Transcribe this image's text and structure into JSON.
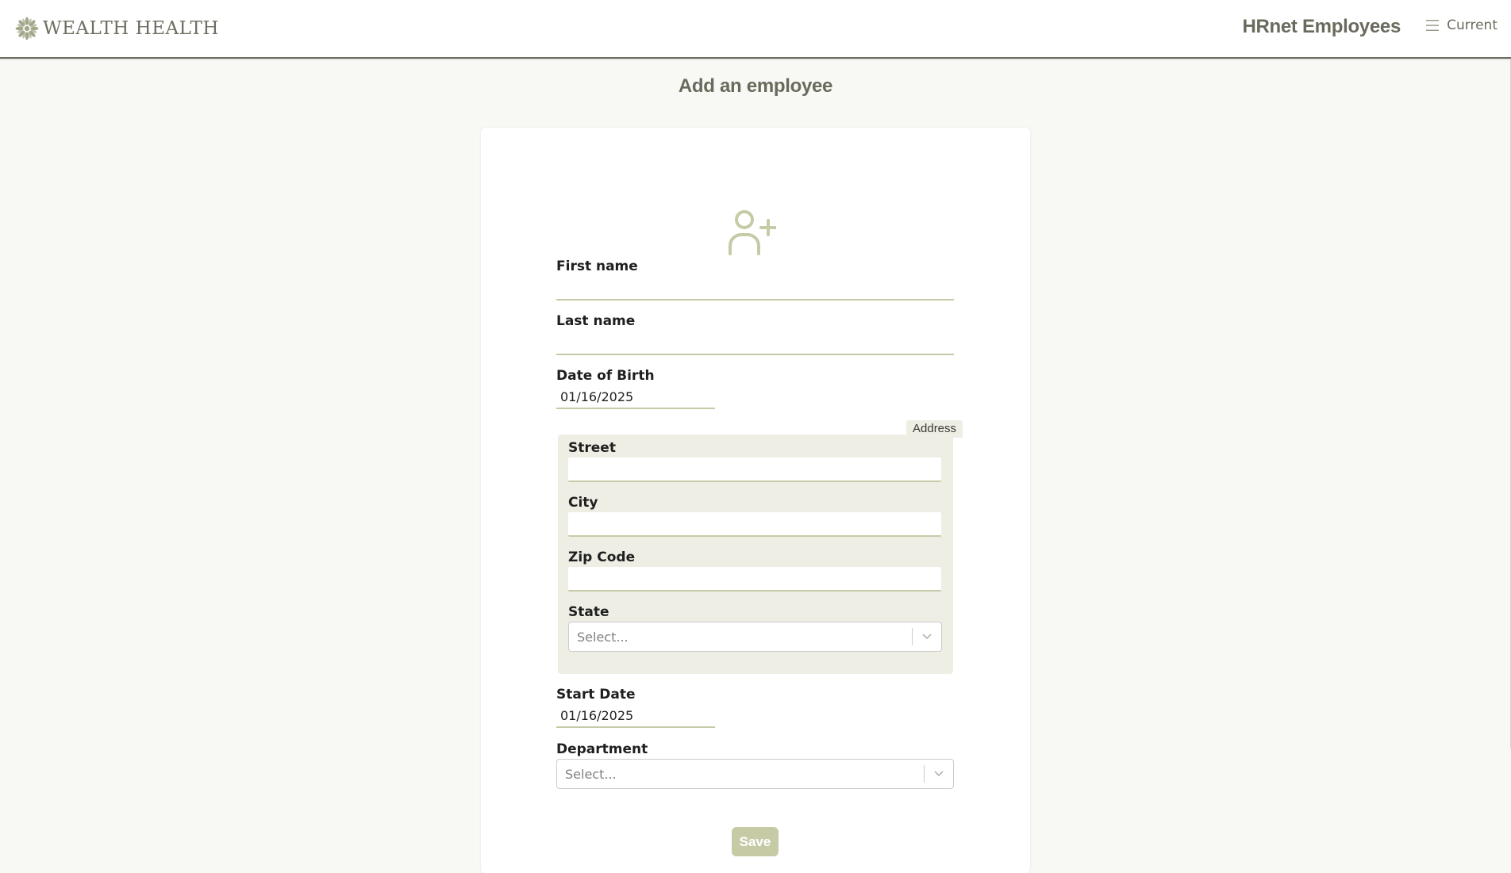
{
  "header": {
    "logo_text": "WEALTH HEALTH",
    "logo_icon": "wellness-flower-icon",
    "app_title": "HRnet Employees",
    "nav_label": "Current",
    "nav_icon": "menu-icon"
  },
  "page": {
    "title": "Add an employee",
    "form_icon": "add-user-icon"
  },
  "form": {
    "first_name_label": "First name",
    "first_name_value": "",
    "last_name_label": "Last name",
    "last_name_value": "",
    "dob_label": "Date of Birth",
    "dob_value": "01/16/2025",
    "address": {
      "legend": "Address",
      "street_label": "Street",
      "street_value": "",
      "city_label": "City",
      "city_value": "",
      "zip_label": "Zip Code",
      "zip_value": "",
      "state_label": "State",
      "state_placeholder": "Select..."
    },
    "start_date_label": "Start Date",
    "start_date_value": "01/16/2025",
    "department_label": "Department",
    "department_placeholder": "Select...",
    "save_label": "Save"
  },
  "colors": {
    "accent": "#c6cba6",
    "header_text": "#6a6a5c",
    "address_bg": "#eeeee5",
    "underline": "#c7caa9"
  }
}
